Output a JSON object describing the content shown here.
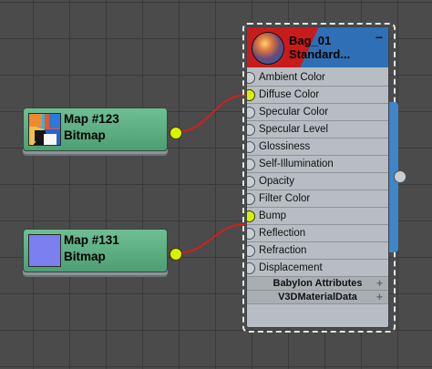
{
  "map_nodes": [
    {
      "title": "Map #123",
      "subtitle": "Bitmap",
      "thumbnail": "bitmap-texture-thumbnail"
    },
    {
      "title": "Map #131",
      "subtitle": "Bitmap",
      "thumbnail": "solid-periwinkle-swatch",
      "thumb_color": "#7b7ff0"
    }
  ],
  "material_node": {
    "title": "Bag_01",
    "subtitle": "Standard...",
    "collapse_label": "−",
    "slots": [
      "Ambient Color",
      "Diffuse Color",
      "Specular Color",
      "Specular Level",
      "Glossiness",
      "Self-Illumination",
      "Opacity",
      "Filter Color",
      "Bump",
      "Reflection",
      "Refraction",
      "Displacement"
    ],
    "rollouts": [
      {
        "label": "Babylon Attributes",
        "icon": "+"
      },
      {
        "label": "V3DMaterialData",
        "icon": "+"
      }
    ]
  },
  "connections": [
    {
      "from": "Map #123",
      "to": "Diffuse Color"
    },
    {
      "from": "Map #131",
      "to": "Bump"
    }
  ],
  "colors": {
    "map_node": "#5fae85",
    "material_header_blue": "#2f6fb5",
    "material_header_red": "#c81c1c",
    "wire": "#d02020",
    "port_active": "#d8f200"
  }
}
